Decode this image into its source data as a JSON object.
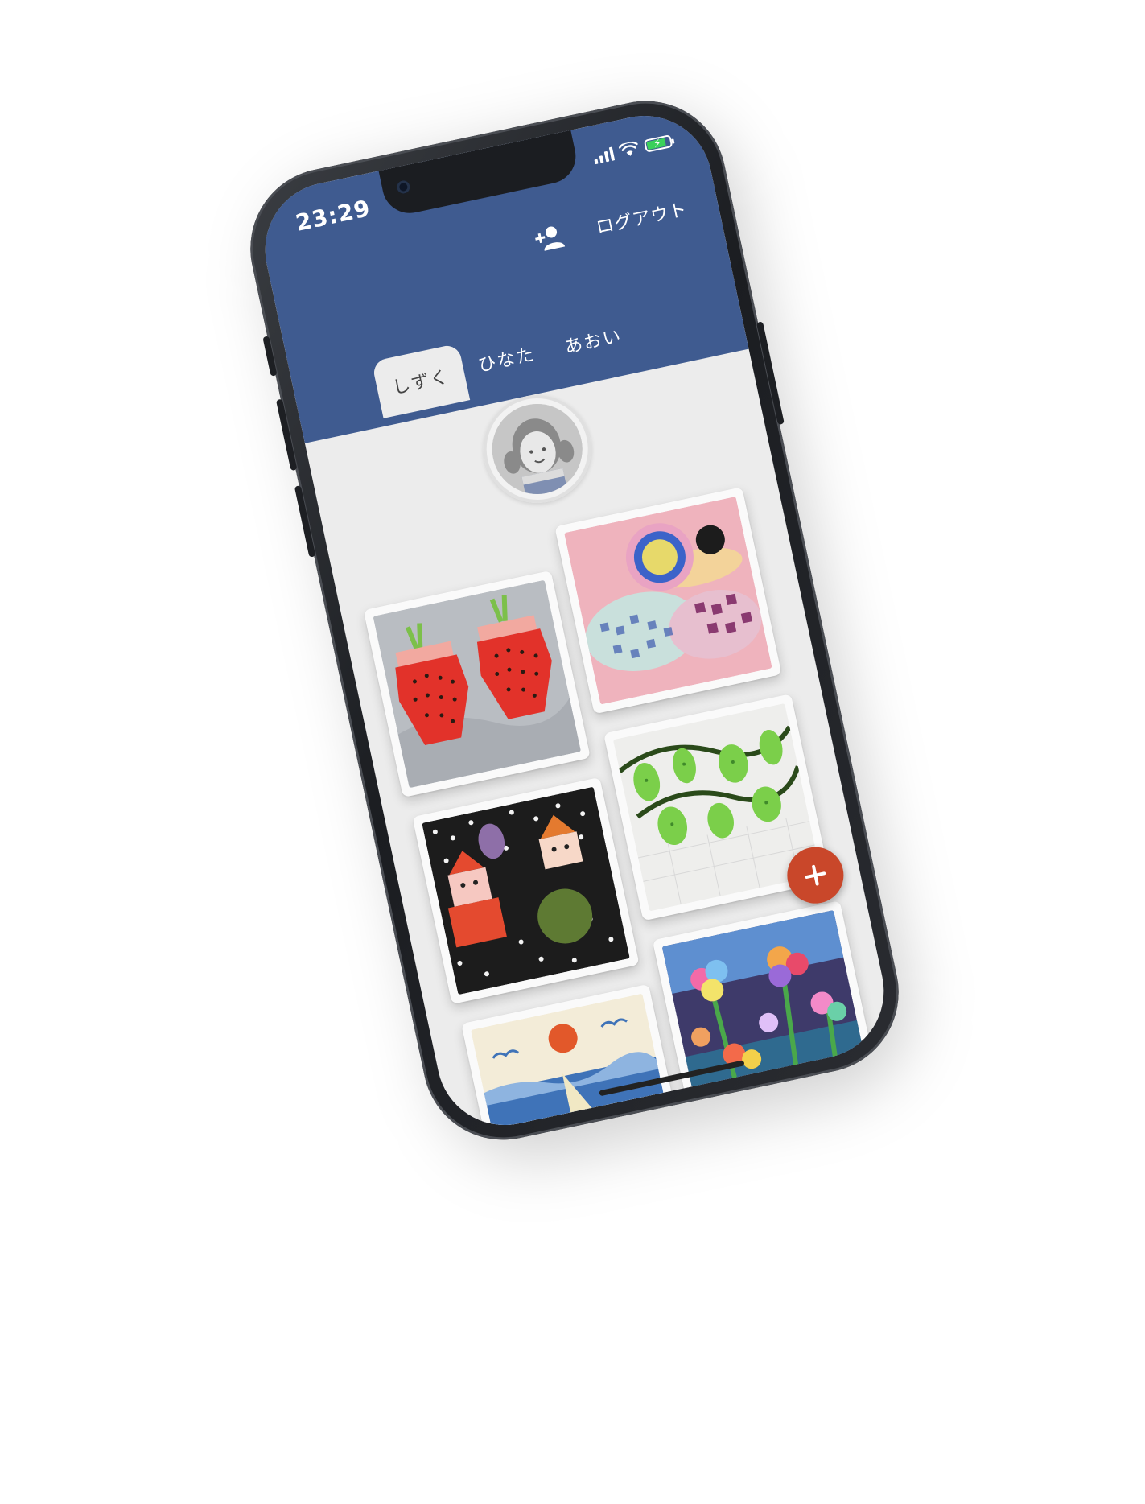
{
  "status_bar": {
    "time": "23:29",
    "icons": [
      "signal-icon",
      "wifi-icon",
      "battery-charging-icon"
    ],
    "battery_level": 0.76
  },
  "header": {
    "add_user_icon": "add-user-icon",
    "logout_label": "ログアウト"
  },
  "tabs": [
    {
      "label": "しずく",
      "active": true
    },
    {
      "label": "ひなた",
      "active": false
    },
    {
      "label": "あおい",
      "active": false
    }
  ],
  "profile": {
    "avatar_icon": "child-avatar-icon"
  },
  "artworks": [
    {
      "subject": "origami strawberries"
    },
    {
      "subject": "snail painting"
    },
    {
      "subject": "origami gnomes"
    },
    {
      "subject": "green vines"
    },
    {
      "subject": "sailboat at sea"
    },
    {
      "subject": "flowers"
    }
  ],
  "fab": {
    "icon": "plus-icon"
  },
  "colors": {
    "header": "#3f5b90",
    "background": "#ececec",
    "fab": "#c9472a"
  }
}
